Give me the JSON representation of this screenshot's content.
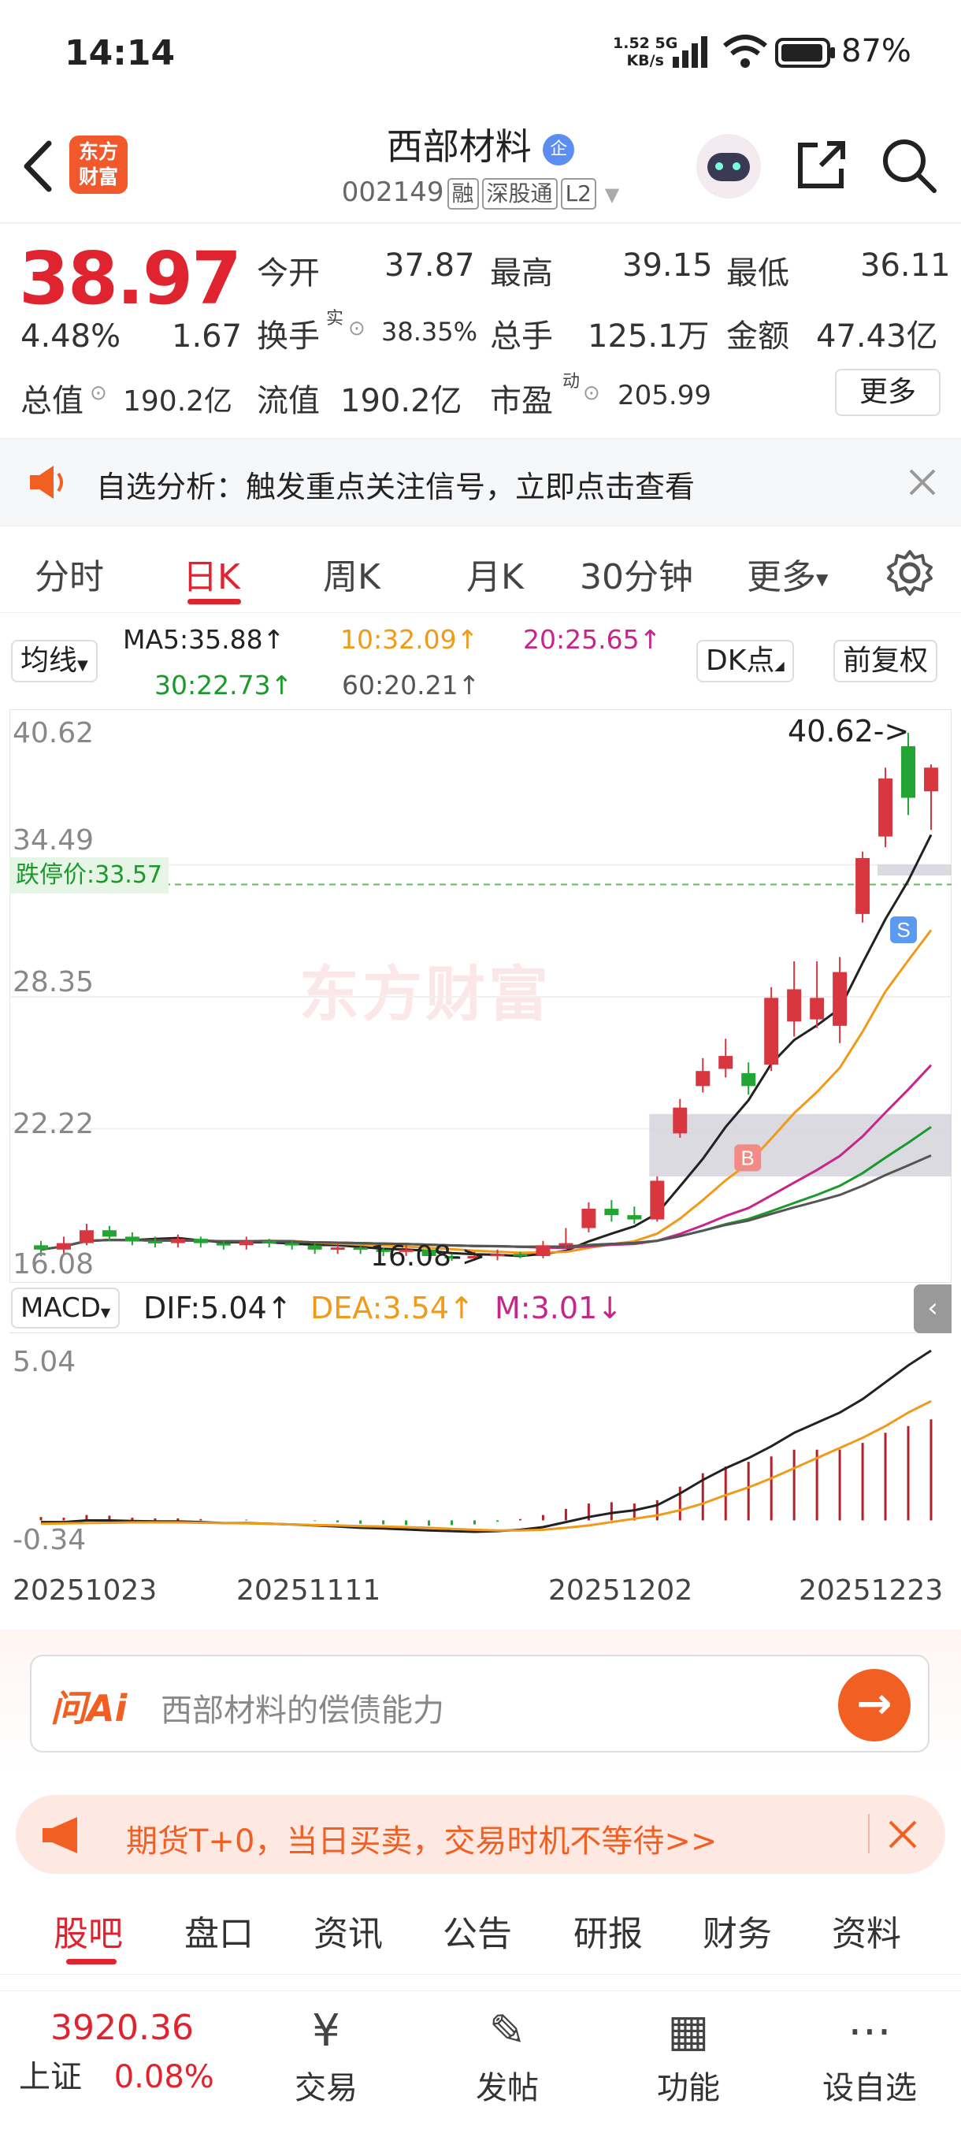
{
  "status": {
    "time": "14:14",
    "net_speed": "1.52",
    "net_unit": "KB/s",
    "net_type": "5G",
    "battery": "87%"
  },
  "header": {
    "title": "西部材料",
    "title_badge": "企",
    "code": "002149",
    "tags": [
      "融",
      "深股通",
      "L2"
    ],
    "logo_line1": "东方",
    "logo_line2": "财富"
  },
  "quote": {
    "price": "38.97",
    "change_pct": "4.48%",
    "change_amt": "1.67",
    "open_label": "今开",
    "open": "37.87",
    "high_label": "最高",
    "high": "39.15",
    "low_label": "最低",
    "low": "36.11",
    "turnover_label": "换手",
    "turnover_sup": "实",
    "turnover": "38.35%",
    "volume_label": "总手",
    "volume": "125.1万",
    "amount_label": "金额",
    "amount": "47.43亿",
    "mktcap_label": "总值",
    "mktcap": "190.2亿",
    "float_label": "流值",
    "float": "190.2亿",
    "pe_label": "市盈",
    "pe_sup": "动",
    "pe": "205.99",
    "more": "更多"
  },
  "alert": {
    "text": "自选分析：触发重点关注信号，立即点击查看"
  },
  "tabs": [
    {
      "label": "分时"
    },
    {
      "label": "日K"
    },
    {
      "label": "周K"
    },
    {
      "label": "月K"
    },
    {
      "label": "30分钟"
    },
    {
      "label": "更多"
    }
  ],
  "ma": {
    "selector": "均线",
    "ma5": "MA5:35.88↑",
    "ma10": "10:32.09↑",
    "ma20": "20:25.65↑",
    "ma30": "30:22.73↑",
    "ma60": "60:20.21↑",
    "dk": "DK点",
    "fq": "前复权",
    "colors": {
      "ma5": "#222222",
      "ma10": "#f09a1a",
      "ma20": "#c8258a",
      "ma30": "#1a9a2a",
      "ma60": "#555555"
    }
  },
  "chart": {
    "y_labels": [
      "40.62",
      "34.49",
      "28.35",
      "22.22",
      "16.08"
    ],
    "limit_down": "跌停价:33.57",
    "max_marker": "40.62->",
    "min_marker": "16.08->",
    "watermark": "东方财富",
    "buy_mark": "B",
    "sell_mark": "S"
  },
  "chart_data": {
    "type": "candlestick",
    "ylim": [
      16.08,
      40.62
    ],
    "candles": [
      {
        "o": 16.8,
        "c": 16.6,
        "h": 17.0,
        "l": 16.3
      },
      {
        "o": 16.6,
        "c": 16.9,
        "h": 17.2,
        "l": 16.4
      },
      {
        "o": 16.9,
        "c": 17.5,
        "h": 17.8,
        "l": 16.8
      },
      {
        "o": 17.5,
        "c": 17.2,
        "h": 17.7,
        "l": 17.0
      },
      {
        "o": 17.2,
        "c": 17.0,
        "h": 17.4,
        "l": 16.8
      },
      {
        "o": 17.0,
        "c": 16.9,
        "h": 17.2,
        "l": 16.7
      },
      {
        "o": 16.9,
        "c": 17.1,
        "h": 17.3,
        "l": 16.7
      },
      {
        "o": 17.1,
        "c": 16.9,
        "h": 17.2,
        "l": 16.7
      },
      {
        "o": 16.9,
        "c": 16.8,
        "h": 17.0,
        "l": 16.6
      },
      {
        "o": 16.8,
        "c": 17.0,
        "h": 17.2,
        "l": 16.6
      },
      {
        "o": 17.0,
        "c": 16.9,
        "h": 17.1,
        "l": 16.7
      },
      {
        "o": 16.9,
        "c": 16.8,
        "h": 17.0,
        "l": 16.6
      },
      {
        "o": 16.8,
        "c": 16.6,
        "h": 16.9,
        "l": 16.4
      },
      {
        "o": 16.6,
        "c": 16.7,
        "h": 16.9,
        "l": 16.4
      },
      {
        "o": 16.7,
        "c": 16.6,
        "h": 16.8,
        "l": 16.4
      },
      {
        "o": 16.6,
        "c": 16.5,
        "h": 16.7,
        "l": 16.3
      },
      {
        "o": 16.5,
        "c": 16.6,
        "h": 16.8,
        "l": 16.3
      },
      {
        "o": 16.6,
        "c": 16.3,
        "h": 16.7,
        "l": 16.1
      },
      {
        "o": 16.3,
        "c": 16.2,
        "h": 16.4,
        "l": 16.08
      },
      {
        "o": 16.2,
        "c": 16.3,
        "h": 16.5,
        "l": 16.08
      },
      {
        "o": 16.3,
        "c": 16.4,
        "h": 16.6,
        "l": 16.1
      },
      {
        "o": 16.4,
        "c": 16.3,
        "h": 16.5,
        "l": 16.2
      },
      {
        "o": 16.3,
        "c": 16.8,
        "h": 17.0,
        "l": 16.2
      },
      {
        "o": 16.8,
        "c": 16.9,
        "h": 17.6,
        "l": 16.7
      },
      {
        "o": 17.6,
        "c": 18.5,
        "h": 18.8,
        "l": 17.4
      },
      {
        "o": 18.5,
        "c": 18.2,
        "h": 18.9,
        "l": 17.9
      },
      {
        "o": 18.2,
        "c": 18.0,
        "h": 18.6,
        "l": 17.8
      },
      {
        "o": 18.0,
        "c": 19.8,
        "h": 20.0,
        "l": 17.9
      },
      {
        "o": 22.0,
        "c": 23.2,
        "h": 23.6,
        "l": 21.8
      },
      {
        "o": 24.2,
        "c": 24.9,
        "h": 25.5,
        "l": 23.9
      },
      {
        "o": 25.0,
        "c": 25.6,
        "h": 26.4,
        "l": 24.6
      },
      {
        "o": 24.8,
        "c": 24.2,
        "h": 25.3,
        "l": 23.8
      },
      {
        "o": 25.2,
        "c": 28.3,
        "h": 28.8,
        "l": 24.9
      },
      {
        "o": 27.2,
        "c": 28.7,
        "h": 30.0,
        "l": 26.5
      },
      {
        "o": 27.3,
        "c": 28.3,
        "h": 30.0,
        "l": 26.9
      },
      {
        "o": 27.0,
        "c": 29.5,
        "h": 30.2,
        "l": 26.2
      },
      {
        "o": 32.2,
        "c": 34.8,
        "h": 35.1,
        "l": 31.8
      },
      {
        "o": 35.8,
        "c": 38.5,
        "h": 39.0,
        "l": 35.3
      },
      {
        "o": 40.0,
        "c": 37.6,
        "h": 40.62,
        "l": 36.8
      },
      {
        "o": 37.9,
        "c": 39.0,
        "h": 39.15,
        "l": 36.11
      }
    ],
    "macd": {
      "dif": 5.04,
      "dea": 3.54,
      "m": 3.01,
      "ylim": [
        -0.34,
        5.04
      ],
      "dif_series": [
        -0.05,
        -0.05,
        0.0,
        0.0,
        -0.02,
        -0.03,
        -0.03,
        -0.05,
        -0.08,
        -0.08,
        -0.1,
        -0.12,
        -0.15,
        -0.18,
        -0.22,
        -0.24,
        -0.27,
        -0.3,
        -0.32,
        -0.34,
        -0.32,
        -0.28,
        -0.2,
        -0.05,
        0.1,
        0.22,
        0.3,
        0.45,
        0.8,
        1.2,
        1.55,
        1.85,
        2.2,
        2.6,
        2.9,
        3.2,
        3.6,
        4.1,
        4.6,
        5.04
      ],
      "dea_series": [
        -0.1,
        -0.09,
        -0.08,
        -0.07,
        -0.06,
        -0.06,
        -0.06,
        -0.07,
        -0.08,
        -0.09,
        -0.1,
        -0.12,
        -0.14,
        -0.15,
        -0.17,
        -0.18,
        -0.2,
        -0.22,
        -0.25,
        -0.28,
        -0.3,
        -0.3,
        -0.28,
        -0.22,
        -0.15,
        -0.05,
        0.05,
        0.15,
        0.3,
        0.5,
        0.75,
        0.98,
        1.25,
        1.55,
        1.85,
        2.15,
        2.45,
        2.8,
        3.2,
        3.54
      ]
    },
    "x_labels": [
      "20251023",
      "20251111",
      "20251202",
      "20251223"
    ]
  },
  "macd_bar": {
    "selector": "MACD",
    "dif": "DIF:5.04↑",
    "dea": "DEA:3.54↑",
    "m": "M:3.01↓",
    "y_top": "5.04",
    "y_bottom": "-0.34"
  },
  "ai": {
    "brand": "问Ai",
    "placeholder": "西部材料的偿债能力"
  },
  "promo": {
    "text": "期货T+0，当日买卖，交易时机不等待>>"
  },
  "bottom_tabs": [
    {
      "label": "股吧"
    },
    {
      "label": "盘口"
    },
    {
      "label": "资讯"
    },
    {
      "label": "公告"
    },
    {
      "label": "研报"
    },
    {
      "label": "财务"
    },
    {
      "label": "资料"
    }
  ],
  "index": {
    "value": "3920.36",
    "name": "上证",
    "pct": "0.08%"
  },
  "nav": [
    {
      "label": "交易"
    },
    {
      "label": "发帖"
    },
    {
      "label": "功能"
    },
    {
      "label": "设自选"
    }
  ]
}
